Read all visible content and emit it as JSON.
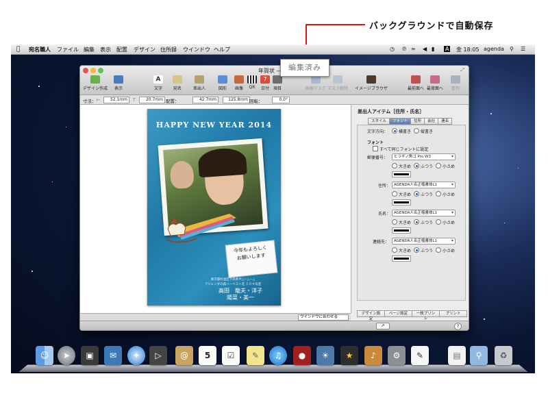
{
  "annotation": {
    "text": "バックグラウンドで自動保存"
  },
  "menubar": {
    "items": [
      "宛名職人",
      "ファイル",
      "編集",
      "表示",
      "配置",
      "デザイン",
      "住所録",
      "ウインドウ",
      "ヘルプ"
    ],
    "right_status": [
      "A",
      "金 18:05",
      "agenda"
    ]
  },
  "window": {
    "title": "年賀状 —",
    "toolbar": [
      "デザイン作成",
      "表示",
      "文字",
      "宛名",
      "差出人",
      "図形",
      "画像",
      "QR",
      "日付",
      "項目",
      "画像マスク",
      "マスク解除",
      "イメージブラウザ",
      "最前面へ",
      "最背面へ",
      "整列"
    ],
    "dim_label": "寸法：",
    "layout_label": "配置：",
    "rotation_label": "回転：",
    "dims": {
      "x": "52.1mm",
      "y": "20.7mm",
      "w": "42.7mm",
      "h": "125.8mm",
      "rotation": "0.0°"
    },
    "zoom_option": "ウインドウに合わせる"
  },
  "badge": "編集済み",
  "card": {
    "title": "HAPPY NEW YEAR 2014",
    "message": [
      "今年もよろしく",
      "お願いします"
    ],
    "address": [
      "東京都杉並区下高井戸△－△－△",
      "アジェンダの森ハーベスト荘 ５０４号室"
    ],
    "sender": [
      "高田　龍夫・洋子",
      "陽菜・美一"
    ]
  },
  "panel": {
    "title": "差出人アイテム［住所・氏名］",
    "tabs": [
      "スタイル",
      "フォント",
      "住所",
      "会社",
      "連名"
    ],
    "direction_label": "文字方向：",
    "direction_options": [
      "横書き",
      "縦書き"
    ],
    "font_header": "フォント",
    "same_font_label": "すべて同じフォントに設定",
    "size_options": [
      "大きめ",
      "ふつう",
      "小さめ"
    ],
    "fields": [
      {
        "label": "郵便番号：",
        "font": "ヒラギノ角ゴ Pro W3"
      },
      {
        "label": "住所：",
        "font": "AGENDA人名正楷書体L1"
      },
      {
        "label": "氏名：",
        "font": "AGENDA人名正楷書体L1"
      },
      {
        "label": "連絡先：",
        "font": "AGENDA人名正楷書体L1"
      }
    ],
    "bottom_tabs": [
      "デザイン設定",
      "ページ設定",
      "一枚プリント",
      "プリント"
    ]
  },
  "dock": {
    "apps": [
      "Finder",
      "Launchpad",
      "Image Capture",
      "Mail Stamp",
      "Safari",
      "FaceTime",
      "Contacts",
      "Calendar",
      "Reminders",
      "Stickies",
      "iTunes",
      "Photo Booth",
      "iPhoto",
      "iMovie",
      "GarageBand",
      "Preferences",
      "TextEdit",
      "Document",
      "Folder",
      "Trash"
    ]
  }
}
